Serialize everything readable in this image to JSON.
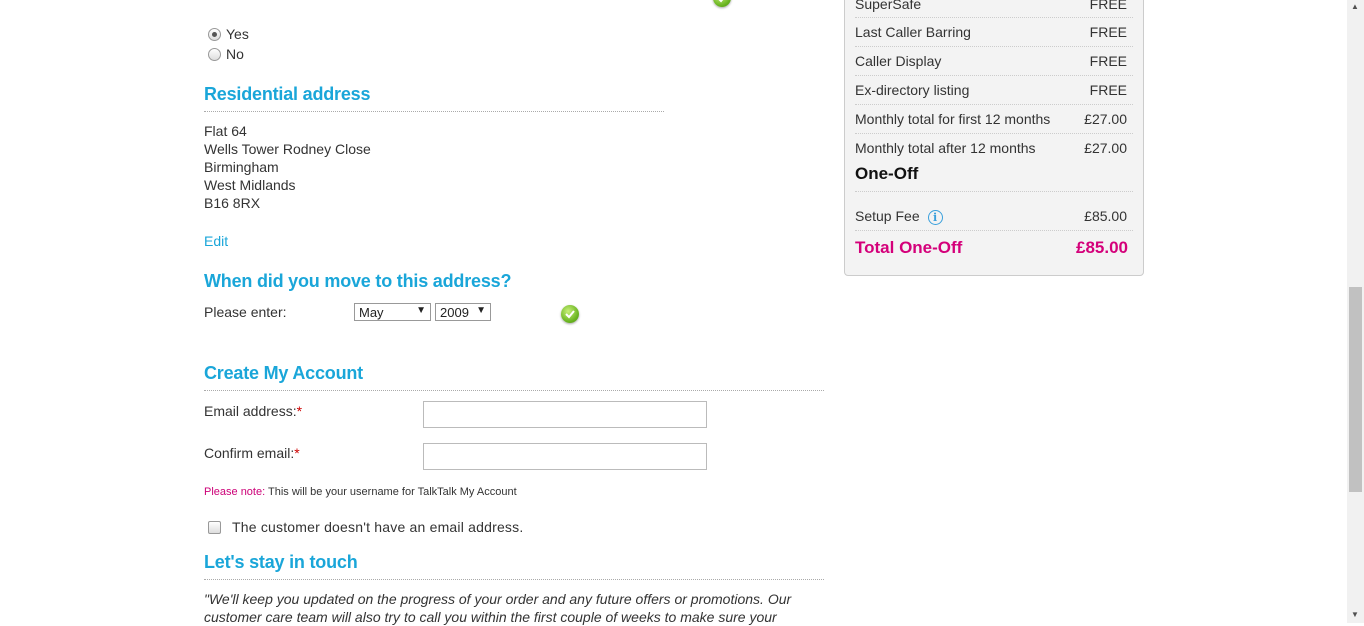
{
  "radio_group": {
    "yes_label": "Yes",
    "no_label": "No",
    "selected": "Yes"
  },
  "residential_address": {
    "heading": "Residential address",
    "lines": [
      "Flat 64",
      "Wells Tower Rodney Close",
      "Birmingham",
      "West Midlands",
      "B16 8RX"
    ],
    "edit_label": "Edit"
  },
  "move_date": {
    "heading": "When did you move to this address?",
    "prompt_label": "Please enter:",
    "month_value": "May",
    "year_value": "2009"
  },
  "create_account": {
    "heading": "Create My Account",
    "email_label": "Email address:",
    "confirm_label": "Confirm email:",
    "required_mark": "*",
    "email_value": "",
    "confirm_value": "",
    "note_prefix": "Please note:",
    "note_text": " This will be your username for TalkTalk My Account",
    "no_email_checkbox_label": "The customer doesn't have an email address.",
    "no_email_checked": false
  },
  "stay_in_touch": {
    "heading": "Let's stay in touch",
    "quote": "\"We'll keep you updated on the progress of your order and any future offers or promotions. Our customer care team will also try to call you within the first couple of weeks to make sure your"
  },
  "summary_panel": {
    "rows": [
      {
        "label": "SuperSafe",
        "value": "FREE"
      },
      {
        "label": "Last Caller Barring",
        "value": "FREE"
      },
      {
        "label": "Caller Display",
        "value": "FREE"
      },
      {
        "label": "Ex-directory listing",
        "value": "FREE"
      },
      {
        "label": "Monthly total for first 12 months",
        "value": "£27.00"
      },
      {
        "label": "Monthly total after 12 months",
        "value": "£27.00"
      }
    ],
    "one_off_title": "One-Off",
    "setup_fee_label": "Setup Fee",
    "setup_fee_value": "£85.00",
    "info_icon_glyph": "i",
    "total_label": "Total One-Off",
    "total_value": "£85.00"
  },
  "colors": {
    "heading_blue": "#1aa6d9",
    "total_pink": "#d4007a",
    "check_green": "#69b420"
  }
}
